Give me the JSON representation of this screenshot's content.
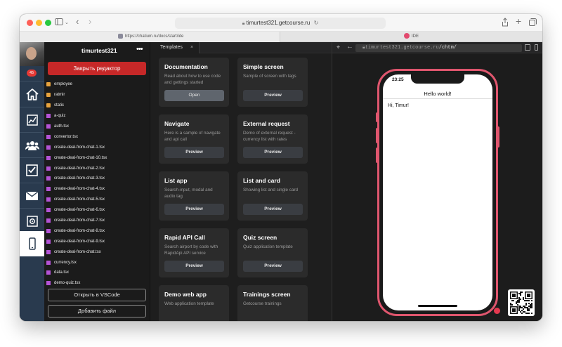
{
  "browser": {
    "address": "timurtest321.getcourse.ru",
    "tabs": [
      {
        "label": "https://chatium.ru/docs/start/ide"
      },
      {
        "label": "IDE"
      }
    ]
  },
  "iconbar": {
    "badge_count": "45",
    "items": [
      "home-icon",
      "chart-icon",
      "users-icon",
      "tasks-icon",
      "mail-icon",
      "safe-icon",
      "phone-icon"
    ]
  },
  "filepanel": {
    "username": "timurtest321",
    "menu_glyph": "•••",
    "close_editor_label": "Закрыть редактор",
    "files": [
      {
        "name": "employee",
        "type": "folder"
      },
      {
        "name": "ratmir",
        "type": "folder"
      },
      {
        "name": "static",
        "type": "folder"
      },
      {
        "name": "a-quiz",
        "type": "tsx"
      },
      {
        "name": "auth.tsx",
        "type": "tsx"
      },
      {
        "name": "convertor.tsx",
        "type": "tsx"
      },
      {
        "name": "create-deal-from-chat-1.tsx",
        "type": "tsx"
      },
      {
        "name": "create-deal-from-chat-10.tsx",
        "type": "tsx"
      },
      {
        "name": "create-deal-from-chat-2.tsx",
        "type": "tsx"
      },
      {
        "name": "create-deal-from-chat-3.tsx",
        "type": "tsx"
      },
      {
        "name": "create-deal-from-chat-4.tsx",
        "type": "tsx"
      },
      {
        "name": "create-deal-from-chat-5.tsx",
        "type": "tsx"
      },
      {
        "name": "create-deal-from-chat-6.tsx",
        "type": "tsx"
      },
      {
        "name": "create-deal-from-chat-7.tsx",
        "type": "tsx"
      },
      {
        "name": "create-deal-from-chat-8.tsx",
        "type": "tsx"
      },
      {
        "name": "create-deal-from-chat-9.tsx",
        "type": "tsx"
      },
      {
        "name": "create-deal-from-chat.tsx",
        "type": "tsx"
      },
      {
        "name": "currency.tsx",
        "type": "tsx"
      },
      {
        "name": "data.tsx",
        "type": "tsx"
      },
      {
        "name": "demo-quiz.tsx",
        "type": "tsx"
      }
    ],
    "open_vscode_label": "Открыть в VSCode",
    "add_file_label": "Добавить файл"
  },
  "templates": {
    "tab_label": "Templates",
    "tab_close": "×",
    "cards": [
      {
        "title": "Documentation",
        "desc": "Read about how to use code and gettings started",
        "button": "Open",
        "primary": true
      },
      {
        "title": "Simple screen",
        "desc": "Sample of screen with tags",
        "button": "Preview"
      },
      {
        "title": "Navigate",
        "desc": "Here is a sample of navigate and api call",
        "button": "Preview"
      },
      {
        "title": "External request",
        "desc": "Demo of external request - currency list with rates",
        "button": "Preview"
      },
      {
        "title": "List app",
        "desc": "Search-input, modal and audio tag",
        "button": "Preview"
      },
      {
        "title": "List and card",
        "desc": "Showing list and single card",
        "button": "Preview"
      },
      {
        "title": "Rapid API Call",
        "desc": "Search airport by code with RapidApi API service",
        "button": "Preview"
      },
      {
        "title": "Quiz screen",
        "desc": "Quiz application template",
        "button": "Preview"
      },
      {
        "title": "Demo web app",
        "desc": "Web application template",
        "button": ""
      },
      {
        "title": "Trainings screen",
        "desc": "Getcourse trainings",
        "button": ""
      }
    ]
  },
  "preview": {
    "address_host": "timurtest321.getcourse.ru",
    "address_path": "/chtm/",
    "phone_time": "23:25",
    "phone_title": "Hello world!",
    "phone_text": "Hi, Timur!"
  },
  "colors": {
    "accent_red": "#c62828",
    "phone_frame": "#e0566e",
    "sidebar": "#293a4e"
  }
}
